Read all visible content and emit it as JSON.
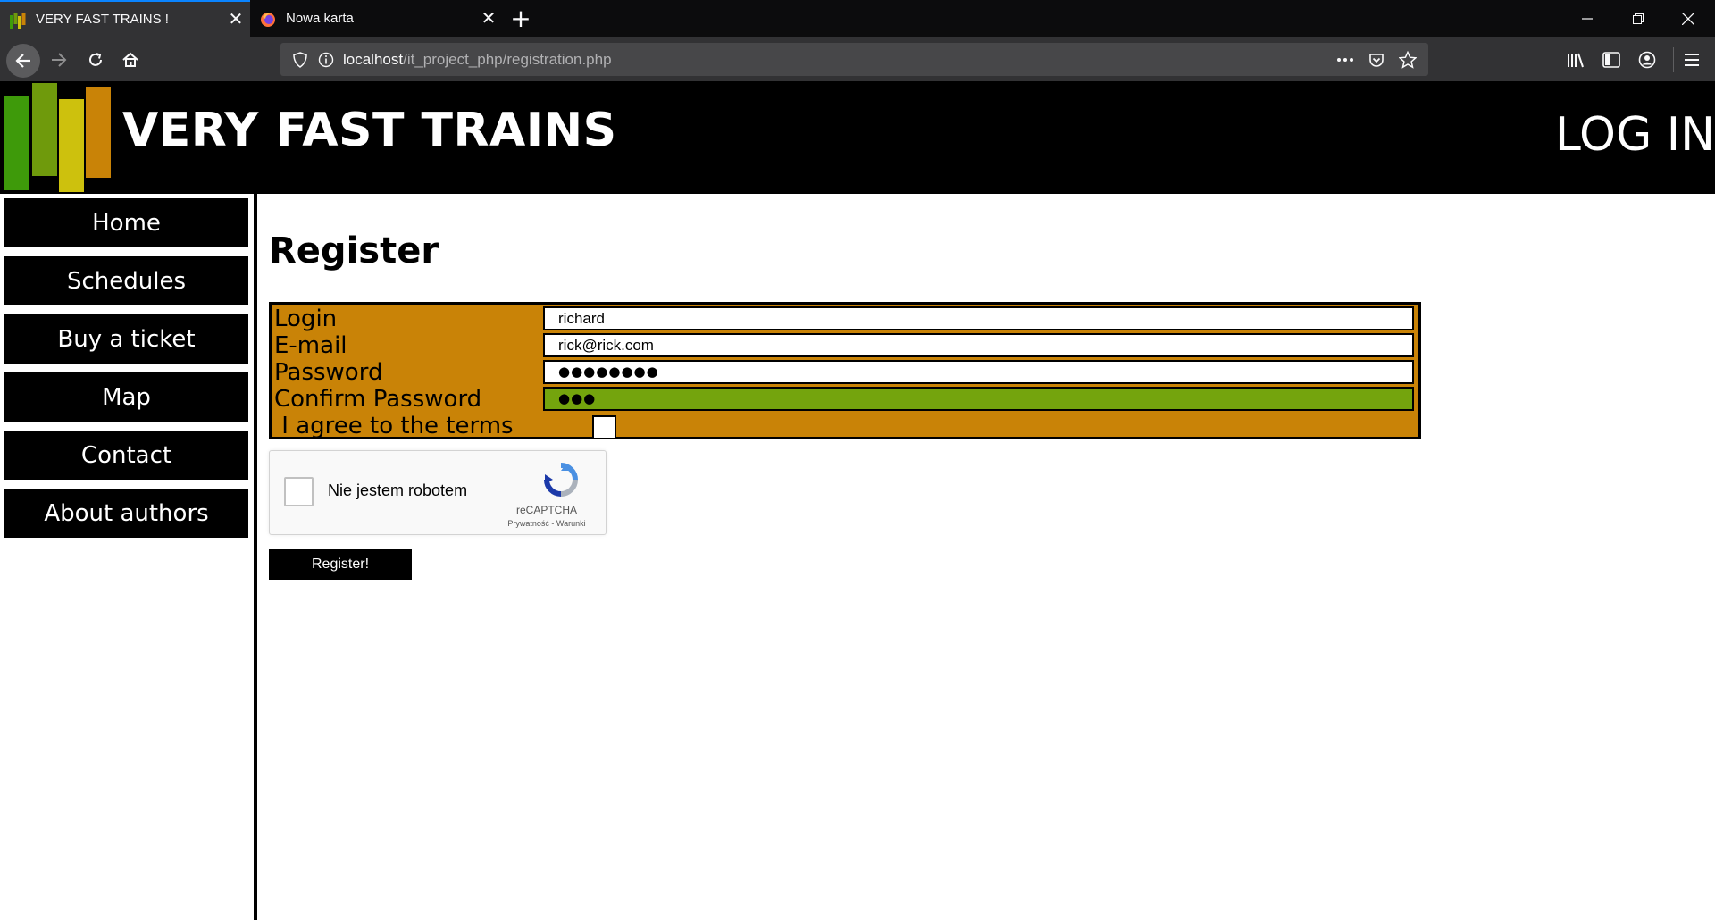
{
  "browser": {
    "tabs": [
      {
        "title": "VERY FAST TRAINS !",
        "icon": "site-bars-icon",
        "active": true
      },
      {
        "title": "Nowa karta",
        "icon": "firefox-icon",
        "active": false
      }
    ],
    "url": {
      "host": "localhost",
      "path": "/it_project_php/registration.php"
    }
  },
  "header": {
    "title": "VERY FAST TRAINS",
    "login_label": "LOG IN",
    "logo_colors": [
      "#3e9a0a",
      "#6f9a0c",
      "#cdc10d",
      "#c98307"
    ]
  },
  "sidebar": {
    "items": [
      {
        "label": "Home"
      },
      {
        "label": "Schedules"
      },
      {
        "label": "Buy a ticket"
      },
      {
        "label": "Map"
      },
      {
        "label": "Contact"
      },
      {
        "label": "About authors"
      }
    ]
  },
  "main": {
    "title": "Register",
    "form": {
      "login_label": "Login",
      "login_value": "richard",
      "email_label": "E-mail",
      "email_value": "rick@rick.com",
      "password_label": "Password",
      "password_value": "●●●●●●●●",
      "confirm_label": "Confirm Password",
      "confirm_value": "●●●",
      "terms_label": " I agree to the terms",
      "terms_checked": false
    },
    "recaptcha": {
      "label": "Nie jestem robotem",
      "brand": "reCAPTCHA",
      "terms": "Prywatność - Warunki"
    },
    "submit_label": "Register!"
  },
  "colors": {
    "form_bg": "#c98307",
    "confirm_bg": "#74a40d",
    "chrome_dark": "#0c0c0d",
    "chrome_mid": "#323234"
  }
}
